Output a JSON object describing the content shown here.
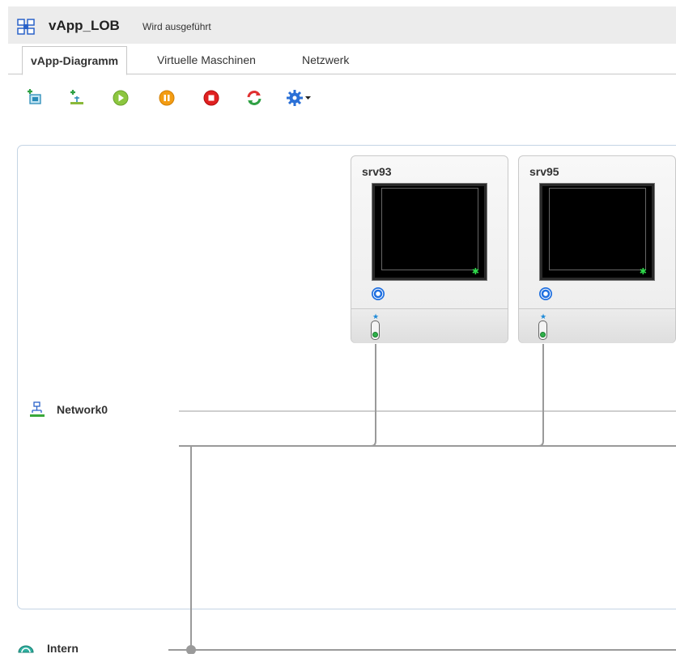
{
  "header": {
    "title": "vApp_LOB",
    "status": "Wird ausgeführt",
    "icon": "vapp-icon"
  },
  "tabs": [
    {
      "label": "vApp-Diagramm",
      "active": true
    },
    {
      "label": "Virtuelle Maschinen",
      "active": false
    },
    {
      "label": "Netzwerk",
      "active": false
    }
  ],
  "toolbar": {
    "icons": [
      "add-vm-icon",
      "add-network-icon",
      "start-icon",
      "suspend-icon",
      "stop-icon",
      "reset-icon",
      "settings-menu-icon"
    ],
    "colors": {
      "start": "#8cc63f",
      "suspend": "#f39c12",
      "stop": "#e02020",
      "reset": "#e03030",
      "settings": "#2a6fd6"
    }
  },
  "diagram": {
    "vms": [
      {
        "name": "srv93",
        "power_state_icon": "powered-on-icon",
        "tools_icon": "vmware-tools-icon"
      },
      {
        "name": "srv95",
        "power_state_icon": "powered-on-icon",
        "tools_icon": "vmware-tools-icon"
      }
    ],
    "networks": [
      {
        "name": "Network0",
        "icon": "vapp-network-icon"
      },
      {
        "name": "Intern",
        "icon": "org-network-icon"
      }
    ]
  }
}
